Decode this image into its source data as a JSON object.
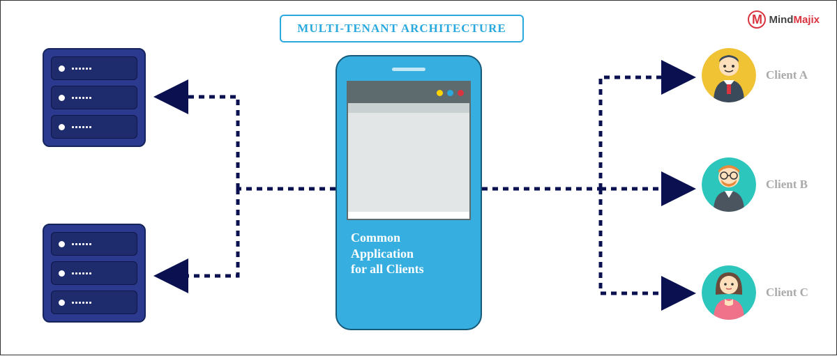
{
  "title": "MULTI-TENANT ARCHITECTURE",
  "brand": {
    "mark": "M",
    "text_left": "Mind",
    "text_right": "Majix"
  },
  "phone": {
    "caption_l1": "Common",
    "caption_l2": "Application",
    "caption_l3": "for all Clients"
  },
  "clients": {
    "a": "Client A",
    "b": "Client B",
    "c": "Client C"
  },
  "colors": {
    "primary": "#36aee0",
    "server": "#2b3a8f",
    "arrow": "#0a1050",
    "brand": "#d9343f"
  }
}
